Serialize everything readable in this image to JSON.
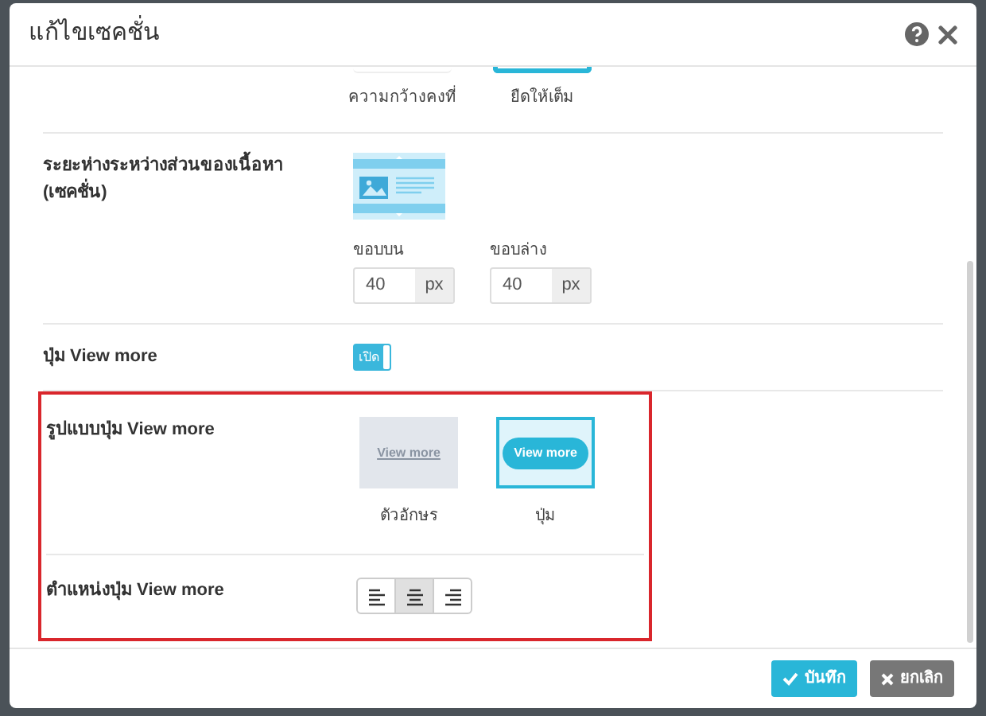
{
  "dialog": {
    "title": "แก้ไขเซคชั่น"
  },
  "rows": [
    {
      "kind": "width",
      "highlighted": false,
      "options": [
        {
          "label": "ความกว้างคงที่",
          "selected": false
        },
        {
          "label": "ยืดให้เต็ม",
          "selected": true
        }
      ]
    },
    {
      "kind": "spacing",
      "highlighted": false,
      "label": "ระยะห่างระหว่างส่วนของเนื้อหา (เซคชั่น)",
      "fields": [
        {
          "label": "ขอบบน",
          "value": "40",
          "unit": "px"
        },
        {
          "label": "ขอบล่าง",
          "value": "40",
          "unit": "px"
        }
      ]
    },
    {
      "kind": "toggle",
      "highlighted": false,
      "label": "ปุ่ม View more",
      "on": true,
      "state_text": "เปิด"
    },
    {
      "kind": "style",
      "highlighted": true,
      "label": "รูปแบบปุ่ม View more",
      "options": [
        {
          "kind": "text",
          "preview": "View more",
          "label": "ตัวอักษร",
          "selected": false
        },
        {
          "kind": "button",
          "preview": "View more",
          "label": "ปุ่ม",
          "selected": true
        }
      ]
    },
    {
      "kind": "align",
      "highlighted": true,
      "label": "ตำแหน่งปุ่ม View more",
      "options": [
        {
          "kind": "left",
          "selected": false
        },
        {
          "kind": "center",
          "selected": true
        },
        {
          "kind": "right",
          "selected": false
        }
      ]
    }
  ],
  "footer_buttons": [
    {
      "kind": "save",
      "label": "บันทึก"
    },
    {
      "kind": "cancel",
      "label": "ยกเลิก"
    }
  ]
}
